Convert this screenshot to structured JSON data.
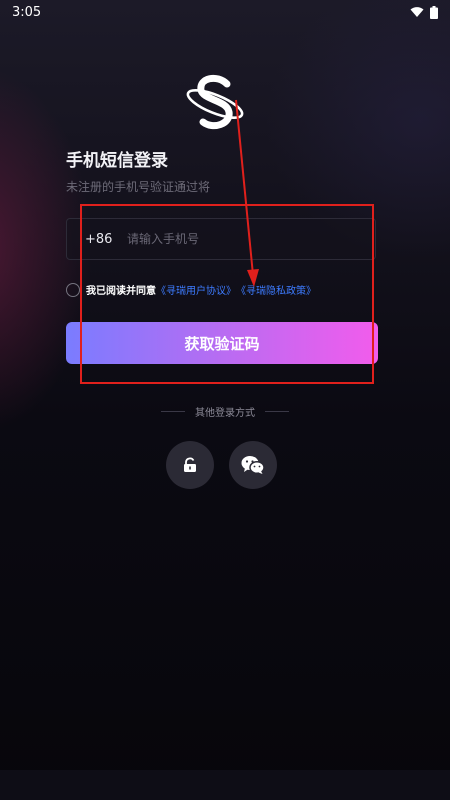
{
  "status_bar": {
    "time": "3:05"
  },
  "login": {
    "title": "手机短信登录",
    "subtitle": "未注册的手机号验证通过将",
    "country_code": "+86",
    "phone_placeholder": "请输入手机号",
    "agree_prefix": "我已阅读并同意",
    "user_agreement_link": "《寻瑞用户协议》",
    "privacy_link": "《寻瑞隐私政策》",
    "get_code_label": "获取验证码",
    "other_methods_label": "其他登录方式"
  },
  "icons": {
    "logo": "planet-logo-icon",
    "password_login": "lock-icon",
    "wechat_login": "wechat-icon"
  },
  "colors": {
    "background": "#0b0a12",
    "link": "#3d7bff",
    "button_gradient_start": "#7a7cff",
    "button_gradient_end": "#f25cec",
    "annotation": "#e0201c"
  }
}
